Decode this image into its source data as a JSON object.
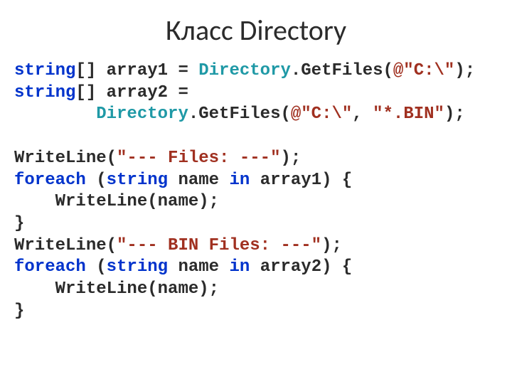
{
  "title": "Класс Directory",
  "code": {
    "kw_string": "string",
    "kw_foreach": "foreach",
    "kw_in": "in",
    "cls_directory": "Directory",
    "l1_a": "[] array1 = ",
    "l1_b": ".GetFiles(",
    "l1_lit": "@\"C:\\\"",
    "l1_c": ");",
    "l2_a": "[] array2 = ",
    "l3_a": "        ",
    "l3_b": ".GetFiles(",
    "l3_lit1": "@\"C:\\\"",
    "l3_c": ", ",
    "l3_lit2": "\"*.BIN\"",
    "l3_d": ");",
    "l5_a": "WriteLine(",
    "l5_lit": "\"--- Files: ---\"",
    "l5_b": ");",
    "l6_a": " (",
    "l6_b": " name ",
    "l6_c": " array1) {",
    "l7": "    WriteLine(name);",
    "l8": "}",
    "l9_a": "WriteLine(",
    "l9_lit": "\"--- BIN Files: ---\"",
    "l9_b": ");",
    "l10_a": " (",
    "l10_b": " name ",
    "l10_c": " array2) {",
    "l11": "    WriteLine(name);",
    "l12": "}"
  }
}
